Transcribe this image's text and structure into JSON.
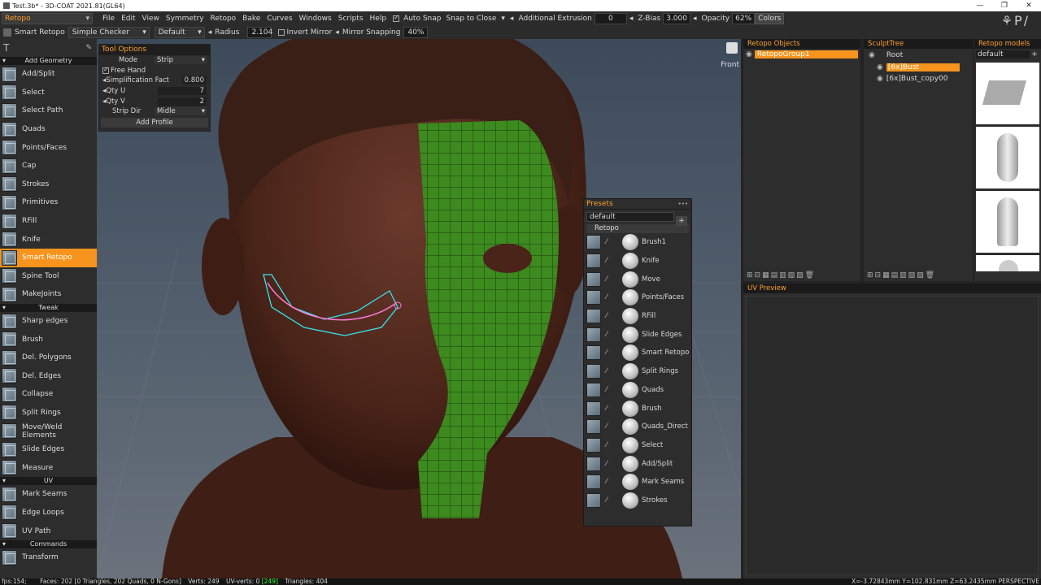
{
  "window": {
    "title": "Test.3b* - 3D-COAT 2021.81(GL64)",
    "controls": [
      "—",
      "❐",
      "✕"
    ]
  },
  "menubar": {
    "room": "Retopo",
    "menus": [
      "File",
      "Edit",
      "View",
      "Symmetry",
      "Retopo",
      "Bake",
      "Curves",
      "Windows",
      "Scripts",
      "Help"
    ],
    "auto_snap": "Auto Snap",
    "snap_to_close": "Snap to Close",
    "additional_extrusion_label": "Additional Extrusion",
    "additional_extrusion_value": "0",
    "zbias_label": "Z-Bias",
    "zbias_value": "3.000",
    "opacity_label": "Opacity",
    "opacity_value": "62%",
    "colors_button": "Colors"
  },
  "toolbar2": {
    "tool_name": "Smart Retopo",
    "shader": "Simple Checker",
    "preset": "Default",
    "radius_label": "Radius",
    "radius_value": "2.104",
    "invert_mirror": "Invert Mirror",
    "mirror_snapping_label": "Mirror Snapping",
    "mirror_snapping_value": "40%"
  },
  "leftpanel": {
    "sections": {
      "add_geometry": "Add Geometry",
      "tweak": "Tweak",
      "uv": "UV",
      "commands": "Commands"
    },
    "add_geometry": [
      "Add/Split",
      "Select",
      "Select Path",
      "Quads",
      "Points/Faces",
      "Cap",
      "Strokes",
      "Primitives",
      "RFill",
      "Knife",
      "Smart Retopo",
      "Spine Tool",
      "MakeJoints"
    ],
    "tweak": [
      "Sharp edges",
      "Brush",
      "Del. Polygons",
      "Del. Edges",
      "Collapse",
      "Split Rings",
      "Move/Weld Elements",
      "Slide Edges",
      "Measure"
    ],
    "uv": [
      "Mark Seams",
      "Edge Loops",
      "UV Path"
    ],
    "commands": [
      "Transform"
    ]
  },
  "tool_options": {
    "title": "Tool Options",
    "mode_label": "Mode",
    "mode_value": "Strip",
    "free_hand": "Free Hand",
    "simplification_label": "Simplification Fact",
    "simplification_value": "0.800",
    "qty_u_label": "Qty U",
    "qty_u_value": "7",
    "qty_v_label": "Qty V",
    "qty_v_value": "2",
    "strip_dir_label": "Strip Dir",
    "strip_dir_value": "Midle",
    "add_profile": "Add Profile"
  },
  "viewport": {
    "view_label": "Front"
  },
  "presets": {
    "title": "Presets",
    "dropdown": "default",
    "group": "Retopo",
    "items": [
      "Brush1",
      "Knife",
      "Move",
      "Points/Faces",
      "RFill",
      "Slide Edges",
      "Smart Retopo",
      "Split Rings",
      "Quads",
      "Brush",
      "Quads_Direct",
      "Select",
      "Add/Split",
      "Mark Seams",
      "Strokes"
    ]
  },
  "retopo_objects": {
    "title": "Retopo Objects",
    "items": [
      "RetopoGroup1"
    ]
  },
  "sculpt_tree": {
    "title": "SculptTree",
    "root": "Root",
    "items": [
      "[6x]Bust",
      "[6x]Bust_copy00"
    ]
  },
  "retopo_models": {
    "title": "Retopo models",
    "dropdown": "default"
  },
  "uv_preview": {
    "title": "UV Preview"
  },
  "statusbar": {
    "fps": "fps:154;",
    "faces": "Faces: 202 [0 Triangles, 202 Quads, 0 N-Gons]",
    "verts": "Verts: 249",
    "uv_verts": "UV-verts: 0",
    "uv_highlight": "[249]",
    "triangles": "Triangles: 404",
    "coords": "X=-3.72843mm  Y=102.831mm  Z=63.2435mm",
    "projection": "PERSPECTIVE"
  }
}
